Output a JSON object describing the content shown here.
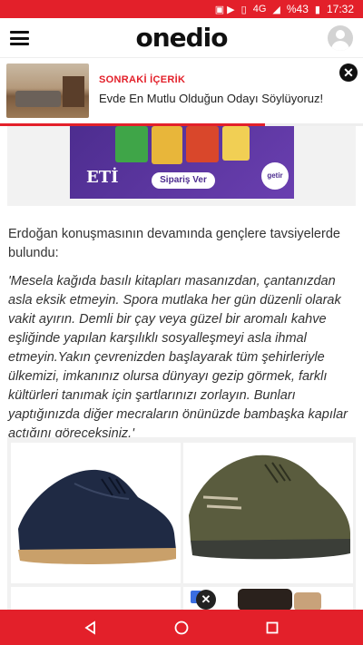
{
  "status_bar": {
    "battery": "%43",
    "time": "17:32",
    "network": "4G"
  },
  "header": {
    "logo": "onedio"
  },
  "next_content": {
    "label": "SONRAKİ İÇERİK",
    "title": "Evde En Mutlu Olduğun Odayı Söylüyoruz!",
    "close": "✕"
  },
  "reading_progress": 0.73,
  "top_ad": {
    "brand": "ETİ",
    "order_button": "Sipariş Ver",
    "partner": "getir"
  },
  "article": {
    "paragraph1": "Erdoğan konuşmasının devamında gençlere tavsiyelerde bulundu:",
    "paragraph2": "'Mesela kağıda basılı kitapları masanızdan, çantanızdan asla eksik etmeyin. Spora mutlaka her gün düzenli olarak vakit ayırın. Demli bir çay veya güzel bir aromalı kahve eşliğinde yapılan karşılıklı sosyalleşmeyi asla ihmal etmeyin.Yakın çevrenizden başlayarak tüm şehirleriyle ülkemizi, imkanınız olursa dünyayı gezip görmek, farklı kültürleri tanımak için şartlarınızı zorlayın. Bunları yaptığınızda diğer mecraların önünüzde bambaşka kapılar açtığını göreceksiniz.'"
  },
  "bottom_ad": {
    "info_icon": "ⓘ ✕",
    "close": "✕"
  },
  "colors": {
    "brand_red": "#e3202a",
    "ad_purple": "#4d2d8f"
  }
}
